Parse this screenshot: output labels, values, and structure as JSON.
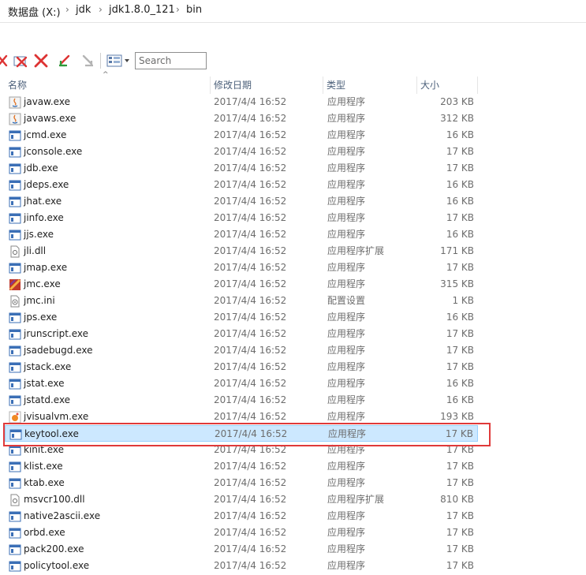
{
  "breadcrumb": {
    "items": [
      "数据盘 (X:)",
      "jdk",
      "jdk1.8.0_121",
      "bin"
    ],
    "separator": "›"
  },
  "toolbar": {
    "search_placeholder": "Search",
    "icons": [
      "cut-icon",
      "delete-icon",
      "delete-red-icon",
      "undo-icon",
      "redo-disabled-icon",
      "view-options-icon"
    ]
  },
  "columns": {
    "name": "名称",
    "date": "修改日期",
    "type": "类型",
    "size": "大小"
  },
  "files": [
    {
      "name": "javaw.exe",
      "date": "2017/4/4 16:52",
      "type": "应用程序",
      "size": "203 KB",
      "icon": "java-icon"
    },
    {
      "name": "javaws.exe",
      "date": "2017/4/4 16:52",
      "type": "应用程序",
      "size": "312 KB",
      "icon": "java-icon"
    },
    {
      "name": "jcmd.exe",
      "date": "2017/4/4 16:52",
      "type": "应用程序",
      "size": "16 KB",
      "icon": "exe-icon"
    },
    {
      "name": "jconsole.exe",
      "date": "2017/4/4 16:52",
      "type": "应用程序",
      "size": "17 KB",
      "icon": "exe-icon"
    },
    {
      "name": "jdb.exe",
      "date": "2017/4/4 16:52",
      "type": "应用程序",
      "size": "17 KB",
      "icon": "exe-icon"
    },
    {
      "name": "jdeps.exe",
      "date": "2017/4/4 16:52",
      "type": "应用程序",
      "size": "16 KB",
      "icon": "exe-icon"
    },
    {
      "name": "jhat.exe",
      "date": "2017/4/4 16:52",
      "type": "应用程序",
      "size": "16 KB",
      "icon": "exe-icon"
    },
    {
      "name": "jinfo.exe",
      "date": "2017/4/4 16:52",
      "type": "应用程序",
      "size": "17 KB",
      "icon": "exe-icon"
    },
    {
      "name": "jjs.exe",
      "date": "2017/4/4 16:52",
      "type": "应用程序",
      "size": "16 KB",
      "icon": "exe-icon"
    },
    {
      "name": "jli.dll",
      "date": "2017/4/4 16:52",
      "type": "应用程序扩展",
      "size": "171 KB",
      "icon": "dll-icon"
    },
    {
      "name": "jmap.exe",
      "date": "2017/4/4 16:52",
      "type": "应用程序",
      "size": "17 KB",
      "icon": "exe-icon"
    },
    {
      "name": "jmc.exe",
      "date": "2017/4/4 16:52",
      "type": "应用程序",
      "size": "315 KB",
      "icon": "jmc-icon"
    },
    {
      "name": "jmc.ini",
      "date": "2017/4/4 16:52",
      "type": "配置设置",
      "size": "1 KB",
      "icon": "ini-icon"
    },
    {
      "name": "jps.exe",
      "date": "2017/4/4 16:52",
      "type": "应用程序",
      "size": "16 KB",
      "icon": "exe-icon"
    },
    {
      "name": "jrunscript.exe",
      "date": "2017/4/4 16:52",
      "type": "应用程序",
      "size": "17 KB",
      "icon": "exe-icon"
    },
    {
      "name": "jsadebugd.exe",
      "date": "2017/4/4 16:52",
      "type": "应用程序",
      "size": "17 KB",
      "icon": "exe-icon"
    },
    {
      "name": "jstack.exe",
      "date": "2017/4/4 16:52",
      "type": "应用程序",
      "size": "17 KB",
      "icon": "exe-icon"
    },
    {
      "name": "jstat.exe",
      "date": "2017/4/4 16:52",
      "type": "应用程序",
      "size": "16 KB",
      "icon": "exe-icon"
    },
    {
      "name": "jstatd.exe",
      "date": "2017/4/4 16:52",
      "type": "应用程序",
      "size": "16 KB",
      "icon": "exe-icon"
    },
    {
      "name": "jvisualvm.exe",
      "date": "2017/4/4 16:52",
      "type": "应用程序",
      "size": "193 KB",
      "icon": "visualvm-icon"
    },
    {
      "name": "keytool.exe",
      "date": "2017/4/4 16:52",
      "type": "应用程序",
      "size": "17 KB",
      "icon": "exe-icon",
      "selected": true
    },
    {
      "name": "kinit.exe",
      "date": "2017/4/4 16:52",
      "type": "应用程序",
      "size": "17 KB",
      "icon": "exe-icon"
    },
    {
      "name": "klist.exe",
      "date": "2017/4/4 16:52",
      "type": "应用程序",
      "size": "17 KB",
      "icon": "exe-icon"
    },
    {
      "name": "ktab.exe",
      "date": "2017/4/4 16:52",
      "type": "应用程序",
      "size": "17 KB",
      "icon": "exe-icon"
    },
    {
      "name": "msvcr100.dll",
      "date": "2017/4/4 16:52",
      "type": "应用程序扩展",
      "size": "810 KB",
      "icon": "dll-icon"
    },
    {
      "name": "native2ascii.exe",
      "date": "2017/4/4 16:52",
      "type": "应用程序",
      "size": "17 KB",
      "icon": "exe-icon"
    },
    {
      "name": "orbd.exe",
      "date": "2017/4/4 16:52",
      "type": "应用程序",
      "size": "17 KB",
      "icon": "exe-icon"
    },
    {
      "name": "pack200.exe",
      "date": "2017/4/4 16:52",
      "type": "应用程序",
      "size": "17 KB",
      "icon": "exe-icon"
    },
    {
      "name": "policytool.exe",
      "date": "2017/4/4 16:52",
      "type": "应用程序",
      "size": "17 KB",
      "icon": "exe-icon"
    }
  ],
  "colors": {
    "selection_bg": "#cce8ff",
    "selection_border": "#99d1ff",
    "annotation_outline": "#e03a3a",
    "header_text": "#4c607a"
  }
}
